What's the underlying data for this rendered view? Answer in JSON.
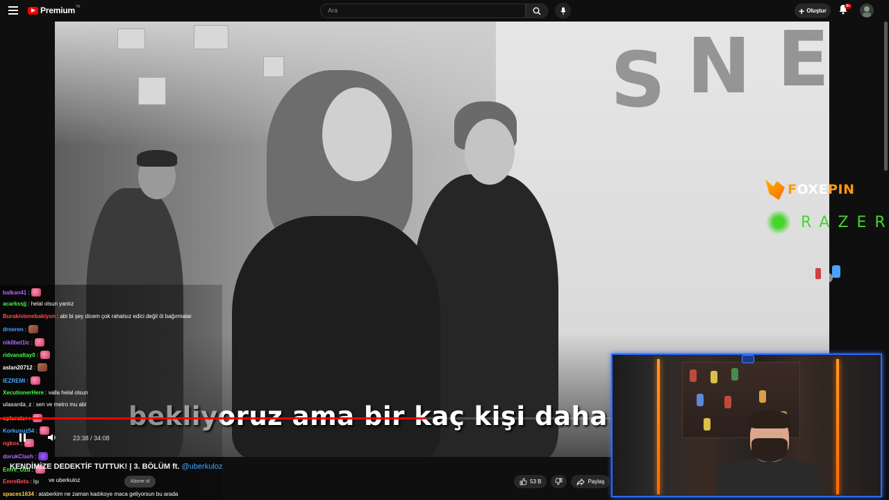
{
  "header": {
    "brand": "Premium",
    "brand_tm": "TR",
    "search_placeholder": "Ara",
    "create_label": "Oluştur",
    "notification_badge": "9+"
  },
  "video": {
    "subtitle_dim": "bekliy",
    "subtitle_main": "oruz ama bir kaç kişi daha",
    "time": "23:38 / 34:08",
    "progress_fraction": 0.693,
    "title_text": "KENDİMİZE DEDEKTİF TUTTUK! | 3. BÖLÜM ft. ",
    "title_mention": "@uberkuloz",
    "channel_text": "ve uberkuloz",
    "subscribe_label": "Abone ol",
    "likes": "53 B",
    "share_label": "Paylaş"
  },
  "sponsors": {
    "foxepin_a": "F",
    "foxepin_b": "OXE",
    "foxepin_c": "PIN",
    "razer": "RAZER"
  },
  "chat": [
    {
      "user": "balkan41",
      "color": "#b36bff",
      "msg": ":",
      "emote": "pink"
    },
    {
      "user": "acarkssjj",
      "color": "#41ff41",
      "msg": ": helal olsun yanlız",
      "emote": ""
    },
    {
      "user": "Burakistenebakiyon",
      "color": "#ff4d4d",
      "msg": ": abi bi şey dicem çok rahatsız edici değil öi bağırmalar",
      "emote": ""
    },
    {
      "user": "drneren",
      "color": "#4aa3ff",
      "msg": ":",
      "emote": "face"
    },
    {
      "user": "nik0bel1lc",
      "color": "#b36bff",
      "msg": ":",
      "emote": "pink"
    },
    {
      "user": "ridvanaltay0",
      "color": "#41ff41",
      "msg": ":",
      "emote": "pink"
    },
    {
      "user": "aslan20712",
      "color": "#ffffff",
      "msg": ":",
      "emote": "face"
    },
    {
      "user": "IEZREMI",
      "color": "#4aa3ff",
      "msg": ":",
      "emote": "pink"
    },
    {
      "user": "XecutionerHere",
      "color": "#41ff41",
      "msg": ": valla helal olsun",
      "emote": ""
    },
    {
      "user": "ulasarda_z",
      "color": "#cccccc",
      "msg": ": sen ve metro mu abi",
      "emote": ""
    },
    {
      "user": "opturator",
      "color": "#ffb347",
      "msg": ":",
      "emote": "pink"
    },
    {
      "user": "Korkusuz54",
      "color": "#4aa3ff",
      "msg": ":",
      "emote": "pink"
    },
    {
      "user": "ngkos",
      "color": "#ff4d4d",
      "msg": ":",
      "emote": "pink"
    },
    {
      "user": "dorukClash",
      "color": "#b36bff",
      "msg": ":",
      "emote": "purple"
    },
    {
      "user": "Emre_Ozu",
      "color": "#41ff41",
      "msg": ":",
      "emote": "pink"
    },
    {
      "user": "EmreBeta",
      "color": "#ff4d4d",
      "msg": ": Işı",
      "emote": ""
    },
    {
      "user": "spaces1634",
      "color": "#ffd24a",
      "msg": ": ataberkim ne zaman kadıkoye maca geliyorsun bu arada",
      "emote": ""
    }
  ],
  "colors": {
    "accent_red": "#ff0000",
    "camera_border": "#2a6cff",
    "led_orange": "#ff7a00"
  },
  "icons": [
    "menu-icon",
    "youtube-logo-icon",
    "search-icon",
    "mic-icon",
    "plus-icon",
    "bell-icon",
    "avatar-icon",
    "like-icon",
    "dislike-icon",
    "share-icon",
    "pause-icon",
    "volume-icon"
  ]
}
